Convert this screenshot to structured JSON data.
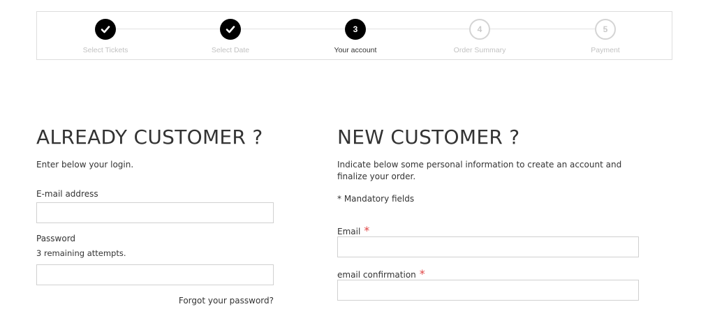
{
  "stepper": {
    "steps": [
      {
        "number": "",
        "label": "Select Tickets",
        "state": "done",
        "icon": "check-icon"
      },
      {
        "number": "",
        "label": "Select Date",
        "state": "done",
        "icon": "check-icon"
      },
      {
        "number": "3",
        "label": "Your account",
        "state": "active"
      },
      {
        "number": "4",
        "label": "Order Summary",
        "state": "todo"
      },
      {
        "number": "5",
        "label": "Payment",
        "state": "todo"
      }
    ]
  },
  "login": {
    "title": "ALREADY CUSTOMER ?",
    "intro": "Enter below your login.",
    "email_label": "E-mail address",
    "email_value": "",
    "password_label": "Password",
    "attempts_text": "3 remaining attempts.",
    "password_value": "",
    "forgot_link": "Forgot your password?"
  },
  "register": {
    "title": "NEW CUSTOMER ?",
    "intro": "Indicate below some personal information to create an account and finalize your order.",
    "mandatory_note": "* Mandatory fields",
    "required_marker": "*",
    "email_label": "Email",
    "email_value": "",
    "email_confirm_label": "email confirmation",
    "email_confirm_value": ""
  },
  "colors": {
    "step_done": "#000000",
    "step_todo_border": "#d4d4d4",
    "required": "#e04545",
    "border": "#d0d0d0"
  }
}
